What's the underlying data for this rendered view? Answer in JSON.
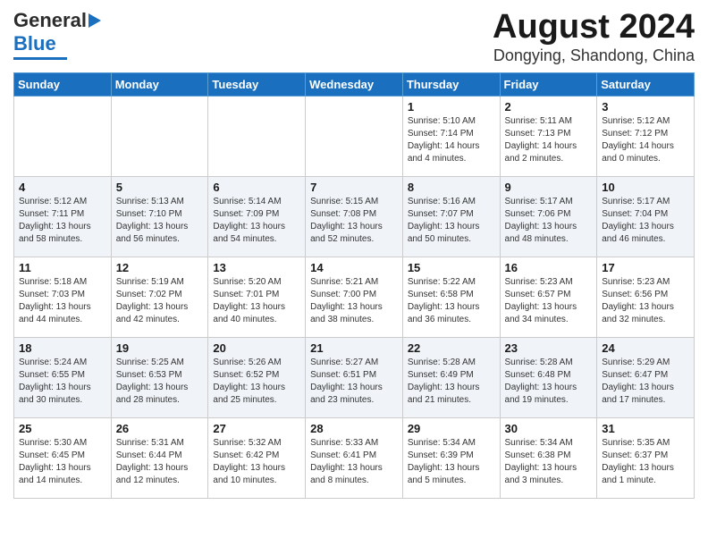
{
  "logo": {
    "general": "General",
    "blue": "Blue",
    "tagline": ""
  },
  "title": "August 2024",
  "subtitle": "Dongying, Shandong, China",
  "days_of_week": [
    "Sunday",
    "Monday",
    "Tuesday",
    "Wednesday",
    "Thursday",
    "Friday",
    "Saturday"
  ],
  "weeks": [
    [
      {
        "day": "",
        "info": ""
      },
      {
        "day": "",
        "info": ""
      },
      {
        "day": "",
        "info": ""
      },
      {
        "day": "",
        "info": ""
      },
      {
        "day": "1",
        "info": "Sunrise: 5:10 AM\nSunset: 7:14 PM\nDaylight: 14 hours\nand 4 minutes."
      },
      {
        "day": "2",
        "info": "Sunrise: 5:11 AM\nSunset: 7:13 PM\nDaylight: 14 hours\nand 2 minutes."
      },
      {
        "day": "3",
        "info": "Sunrise: 5:12 AM\nSunset: 7:12 PM\nDaylight: 14 hours\nand 0 minutes."
      }
    ],
    [
      {
        "day": "4",
        "info": "Sunrise: 5:12 AM\nSunset: 7:11 PM\nDaylight: 13 hours\nand 58 minutes."
      },
      {
        "day": "5",
        "info": "Sunrise: 5:13 AM\nSunset: 7:10 PM\nDaylight: 13 hours\nand 56 minutes."
      },
      {
        "day": "6",
        "info": "Sunrise: 5:14 AM\nSunset: 7:09 PM\nDaylight: 13 hours\nand 54 minutes."
      },
      {
        "day": "7",
        "info": "Sunrise: 5:15 AM\nSunset: 7:08 PM\nDaylight: 13 hours\nand 52 minutes."
      },
      {
        "day": "8",
        "info": "Sunrise: 5:16 AM\nSunset: 7:07 PM\nDaylight: 13 hours\nand 50 minutes."
      },
      {
        "day": "9",
        "info": "Sunrise: 5:17 AM\nSunset: 7:06 PM\nDaylight: 13 hours\nand 48 minutes."
      },
      {
        "day": "10",
        "info": "Sunrise: 5:17 AM\nSunset: 7:04 PM\nDaylight: 13 hours\nand 46 minutes."
      }
    ],
    [
      {
        "day": "11",
        "info": "Sunrise: 5:18 AM\nSunset: 7:03 PM\nDaylight: 13 hours\nand 44 minutes."
      },
      {
        "day": "12",
        "info": "Sunrise: 5:19 AM\nSunset: 7:02 PM\nDaylight: 13 hours\nand 42 minutes."
      },
      {
        "day": "13",
        "info": "Sunrise: 5:20 AM\nSunset: 7:01 PM\nDaylight: 13 hours\nand 40 minutes."
      },
      {
        "day": "14",
        "info": "Sunrise: 5:21 AM\nSunset: 7:00 PM\nDaylight: 13 hours\nand 38 minutes."
      },
      {
        "day": "15",
        "info": "Sunrise: 5:22 AM\nSunset: 6:58 PM\nDaylight: 13 hours\nand 36 minutes."
      },
      {
        "day": "16",
        "info": "Sunrise: 5:23 AM\nSunset: 6:57 PM\nDaylight: 13 hours\nand 34 minutes."
      },
      {
        "day": "17",
        "info": "Sunrise: 5:23 AM\nSunset: 6:56 PM\nDaylight: 13 hours\nand 32 minutes."
      }
    ],
    [
      {
        "day": "18",
        "info": "Sunrise: 5:24 AM\nSunset: 6:55 PM\nDaylight: 13 hours\nand 30 minutes."
      },
      {
        "day": "19",
        "info": "Sunrise: 5:25 AM\nSunset: 6:53 PM\nDaylight: 13 hours\nand 28 minutes."
      },
      {
        "day": "20",
        "info": "Sunrise: 5:26 AM\nSunset: 6:52 PM\nDaylight: 13 hours\nand 25 minutes."
      },
      {
        "day": "21",
        "info": "Sunrise: 5:27 AM\nSunset: 6:51 PM\nDaylight: 13 hours\nand 23 minutes."
      },
      {
        "day": "22",
        "info": "Sunrise: 5:28 AM\nSunset: 6:49 PM\nDaylight: 13 hours\nand 21 minutes."
      },
      {
        "day": "23",
        "info": "Sunrise: 5:28 AM\nSunset: 6:48 PM\nDaylight: 13 hours\nand 19 minutes."
      },
      {
        "day": "24",
        "info": "Sunrise: 5:29 AM\nSunset: 6:47 PM\nDaylight: 13 hours\nand 17 minutes."
      }
    ],
    [
      {
        "day": "25",
        "info": "Sunrise: 5:30 AM\nSunset: 6:45 PM\nDaylight: 13 hours\nand 14 minutes."
      },
      {
        "day": "26",
        "info": "Sunrise: 5:31 AM\nSunset: 6:44 PM\nDaylight: 13 hours\nand 12 minutes."
      },
      {
        "day": "27",
        "info": "Sunrise: 5:32 AM\nSunset: 6:42 PM\nDaylight: 13 hours\nand 10 minutes."
      },
      {
        "day": "28",
        "info": "Sunrise: 5:33 AM\nSunset: 6:41 PM\nDaylight: 13 hours\nand 8 minutes."
      },
      {
        "day": "29",
        "info": "Sunrise: 5:34 AM\nSunset: 6:39 PM\nDaylight: 13 hours\nand 5 minutes."
      },
      {
        "day": "30",
        "info": "Sunrise: 5:34 AM\nSunset: 6:38 PM\nDaylight: 13 hours\nand 3 minutes."
      },
      {
        "day": "31",
        "info": "Sunrise: 5:35 AM\nSunset: 6:37 PM\nDaylight: 13 hours\nand 1 minute."
      }
    ]
  ]
}
